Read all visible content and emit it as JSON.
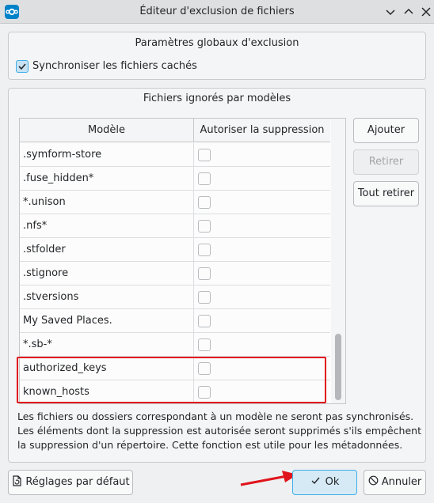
{
  "window": {
    "title": "Éditeur d'exclusion de fichiers"
  },
  "global_group": {
    "title": "Paramètres globaux d'exclusion",
    "sync_hidden_label": "Synchroniser les fichiers cachés",
    "sync_hidden_checked": true
  },
  "patterns_group": {
    "title": "Fichiers ignorés par modèles",
    "columns": [
      "Modèle",
      "Autoriser la suppression"
    ],
    "rows": [
      {
        "pattern": ".symform-store",
        "allow_delete": false
      },
      {
        "pattern": ".fuse_hidden*",
        "allow_delete": false
      },
      {
        "pattern": "*.unison",
        "allow_delete": false
      },
      {
        "pattern": ".nfs*",
        "allow_delete": false
      },
      {
        "pattern": ".stfolder",
        "allow_delete": false
      },
      {
        "pattern": ".stignore",
        "allow_delete": false
      },
      {
        "pattern": ".stversions",
        "allow_delete": false
      },
      {
        "pattern": "My Saved Places.",
        "allow_delete": false
      },
      {
        "pattern": "*.sb-*",
        "allow_delete": false
      },
      {
        "pattern": "authorized_keys",
        "allow_delete": false
      },
      {
        "pattern": "known_hosts",
        "allow_delete": false
      }
    ],
    "buttons": {
      "add": "Ajouter",
      "remove": "Retirer",
      "remove_all": "Tout retirer"
    },
    "info_lines": [
      "Les fichiers ou dossiers correspondant à un modèle ne seront pas synchronisés.",
      "Les éléments dont la suppression est autorisée seront supprimés s'ils empêchent",
      "la suppression d'un répertoire. Cette fonction est utile pour les métadonnées."
    ]
  },
  "footer": {
    "defaults_label": "Réglages par défaut",
    "ok_label": "Ok",
    "cancel_label": "Annuler"
  },
  "colors": {
    "accent": "#3daee9",
    "highlight": "#e0141c"
  }
}
